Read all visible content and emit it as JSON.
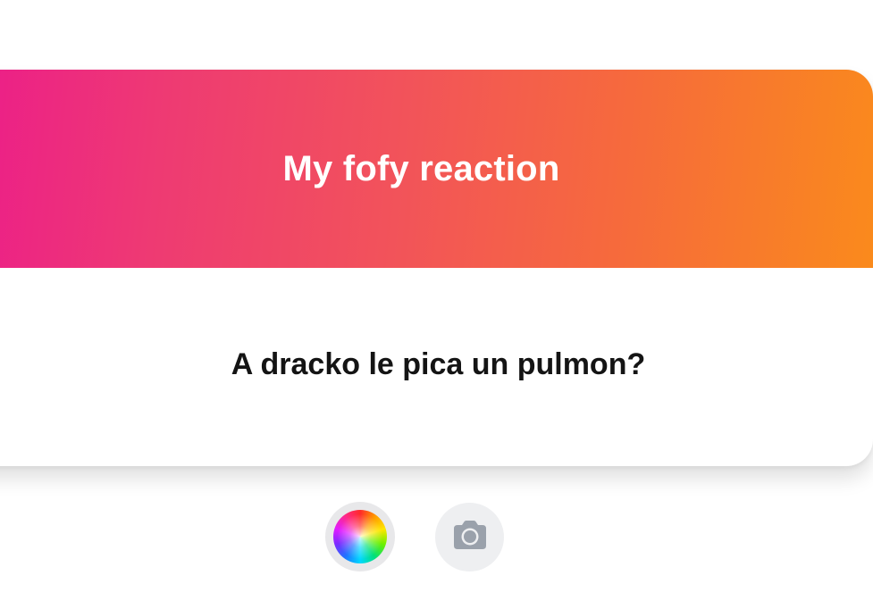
{
  "card": {
    "title": "My fofy reaction",
    "question": "A dracko le pica un pulmon?"
  },
  "controls": {
    "color_button_icon": "color-wheel-icon",
    "camera_button_icon": "camera-icon"
  },
  "colors": {
    "gradient_start": "#ec1c8a",
    "gradient_end": "#fa8a1c",
    "title_text": "#ffffff",
    "question_text": "#141414",
    "camera_icon": "#9aa1ab"
  }
}
